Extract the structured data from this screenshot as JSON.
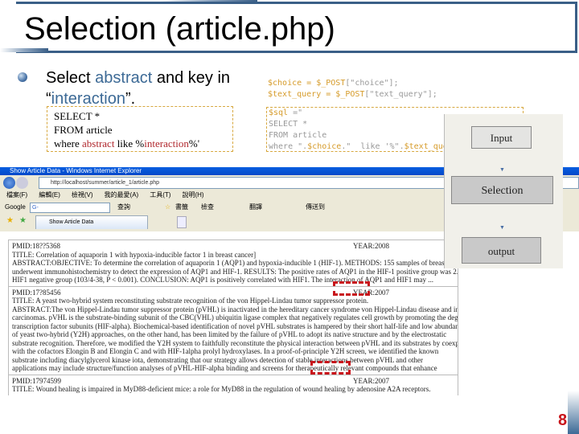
{
  "slide": {
    "title": "Selection (article.php)",
    "bullet": {
      "pre": "Select ",
      "kw1": "abstract",
      "mid": " and key in ",
      "q1": "“",
      "kw2": "interaction",
      "q2": "”."
    },
    "sql": {
      "line1": "SELECT *",
      "line2": "FROM article",
      "l3_pre": "where ",
      "l3_field": "abstract",
      "l3_mid": "  like %",
      "l3_term": "interaction",
      "l3_post": "%'"
    },
    "php": {
      "line1a": "$choice = ",
      "line1b": "$_POST",
      "line1c": "[\"choice\"];",
      "line2a": "$text_query = ",
      "line2b": "$_POST",
      "line2c": "[\"text_query\"];",
      "box1a": "$sql",
      "box1b": " =\"",
      "box2": "SELECT *",
      "box3": "FROM article",
      "box4a": "where \".",
      "box4b": "$choice",
      ".box4c": "",
      "box4c": ".\"  like '%\".",
      "box4d": "$text_query",
      "box4e": ".\"% \";"
    },
    "page_number": "8"
  },
  "browser": {
    "window_title": "Show Article Data - Windows Internet Explorer",
    "url": "http://localhost/summer/article_1/article.php",
    "search_placeholder": "Google",
    "menu": [
      "檔案(F)",
      "編輯(E)",
      "檢視(V)",
      "我的最愛(A)",
      "工具(T)",
      "說明(H)"
    ],
    "google_label": "Google",
    "google_go": "G-",
    "toolbar_items": [
      "查詢",
      "書籤",
      "檢查",
      "翻譯",
      "傳送到"
    ],
    "tab_label": "Show Article Data",
    "records": [
      {
        "pmid": "PMID:18??5368",
        "year": "YEAR:2008",
        "title": "TITLE: Correlation of aquaporin 1 with hypoxia-inducible factor 1 in breast cancer]",
        "abstract": [
          "ABSTRACT:OBJECTIVE: To determine the correlation of aquaporin 1 (AQP1) and hypoxia-inducible 1 (HIF-1). METHODS: 155 samples of breast cancer obtained during radical mastectomy",
          "underwent immunohistochemistry to detect the expression of AQP1 and HIF-1. RESULTS: The positive rates of AQP1 in the HIF-1 positive group was 2.07+1.65, significantly higher than",
          "HIF1 negative group (103/4-38, P < 0.001). CONCLUSION: AQP1 is positively correlated with HIF1. The interaction of AQP1 and HIF1 may ..."
        ]
      },
      {
        "pmid": "PMID:17?85456",
        "year": "YEAR:2007",
        "title": "TITLE: A yeast two-hybrid system reconstituting substrate recognition of the von Hippel-Lindau tumor suppressor protein.",
        "abstract": [
          "ABSTRACT:The von Hippel-Lindau tumor suppressor protein (pVHL) is inactivated in the hereditary cancer syndrome von Hippel-Lindau disease and in sporadic clear cell renal",
          "carcinomas. pVHL is the substrate-binding subunit of the CBC(VHL) ubiquitin ligase complex that negatively regulates cell growth by promoting the degradation of hypoxia-inducible",
          "transcription factor subunits (HIF-alpha). Biochemical-based identification of novel pVHL substrates is hampered by their short half-life and low abundance. The use",
          "of yeast two-hybrid (Y2H) approaches, on the other hand, has been limited by the failure of pVHL to adopt its native structure and by the electrostatic",
          "substrate recognition. Therefore, we modified the Y2H system to faithfully reconstitute the physical interaction between pVHL and its substrates by coexpressing",
          "with the cofactors Elongin B and Elongin C and with HIF-1alpha prolyl hydroxylases. In a proof-of-principle Y2H screen, we identified the known",
          "substrate including diacylglycerol kinase iota, demonstrating that our strategy allows detection of stable interactions between pVHL and other",
          "applications may include structure/function analyses of pVHL-HIF-alpha binding and screens for therapeutically relevant compounds that enhance"
        ]
      },
      {
        "pmid": "PMID:17974599",
        "year": "YEAR:2007",
        "title": "TITLE: Wound healing is impaired in MyD88-deficient mice: a role for MyD88 in the regulation of wound healing by adenosine A2A receptors.",
        "abstract": []
      }
    ]
  },
  "flow": {
    "input": "Input",
    "selection": "Selection",
    "output": "output"
  }
}
